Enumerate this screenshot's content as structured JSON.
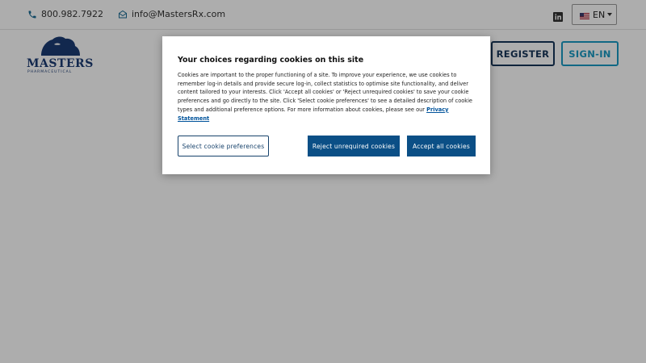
{
  "topbar": {
    "phone": "800.982.7922",
    "email": "info@MastersRx.com",
    "language": "EN",
    "icons": {
      "phone": "phone-icon",
      "email": "mail-icon",
      "social": "linkedin-icon",
      "flag": "us-flag-icon",
      "caret": "chevron-down-icon"
    }
  },
  "header": {
    "logo_text": "MASTERS",
    "logo_sub": "PHARMACEUTICAL",
    "register_label": "REGISTER",
    "signin_label": "SIGN-IN"
  },
  "cookie_dialog": {
    "title": "Your choices regarding cookies on this site",
    "body": "Cookies are important to the proper functioning of a site. To improve your experience, we use cookies to remember log-in details and provide secure log-in, collect statistics to optimise site functionality, and deliver content tailored to your interests. Click 'Accept all cookies' or 'Reject unrequired cookies' to save your cookie preferences and go directly to the site. Click 'Select cookie preferences' to see a detailed description of cookie types and additional preference options. For more information about cookies, please see our",
    "privacy_link": "Privacy Statement",
    "prefs_button": "Select cookie preferences",
    "reject_button": "Reject unrequired cookies",
    "accept_button": "Accept all cookies"
  },
  "colors": {
    "navy": "#173559",
    "teal": "#1a9ac3",
    "button_blue": "#0b4f86",
    "overlay": "rgba(0,0,0,0.32)"
  }
}
